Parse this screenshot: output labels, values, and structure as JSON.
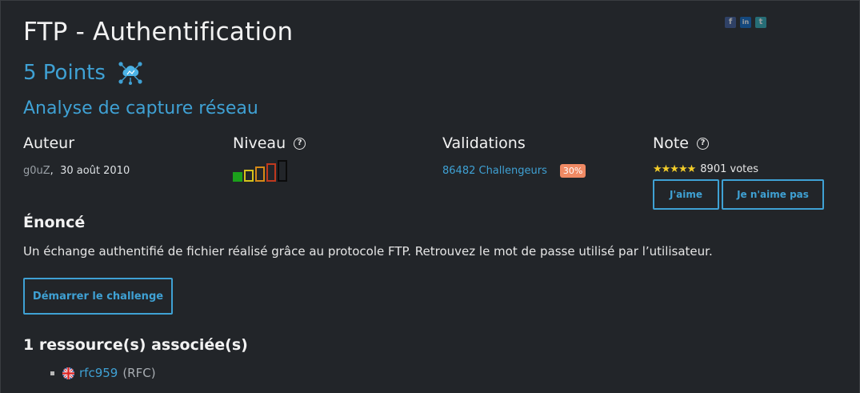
{
  "challenge": {
    "title": "FTP - Authentification",
    "points": "5 Points",
    "category": "Analyse de capture réseau"
  },
  "share": {
    "icons": [
      "facebook-icon",
      "linkedin-icon",
      "twitter-icon"
    ],
    "fb": "f",
    "li": "in",
    "tw": "t"
  },
  "author": {
    "heading": "Auteur",
    "name": "g0uZ",
    "date_sep": ",",
    "date": "30 août 2010"
  },
  "level": {
    "heading": "Niveau",
    "help": "?",
    "current": 1,
    "max": 5
  },
  "validations": {
    "heading": "Validations",
    "count_link": "86482 Challengeurs",
    "percent": "30%"
  },
  "note": {
    "heading": "Note",
    "help": "?",
    "stars": "★★★★★",
    "rating": 5,
    "votes": "8901 votes",
    "like_label": "J'aime",
    "dislike_label": "Je n'aime pas"
  },
  "statement": {
    "heading": "Énoncé",
    "text": "Un échange authentifié de fichier réalisé grâce au protocole FTP. Retrouvez le mot de passe utilisé par l’utilisateur.",
    "start_label": "Démarrer le challenge"
  },
  "resources": {
    "heading": "1 ressource(s) associée(s)",
    "items": [
      {
        "link": "rfc959",
        "type": "(RFC)",
        "flag": "uk-flag-icon"
      }
    ]
  },
  "colors": {
    "accent": "#3fa1d4",
    "background": "#222529",
    "badge": "#f08a64",
    "stars": "#f3cd2a"
  }
}
